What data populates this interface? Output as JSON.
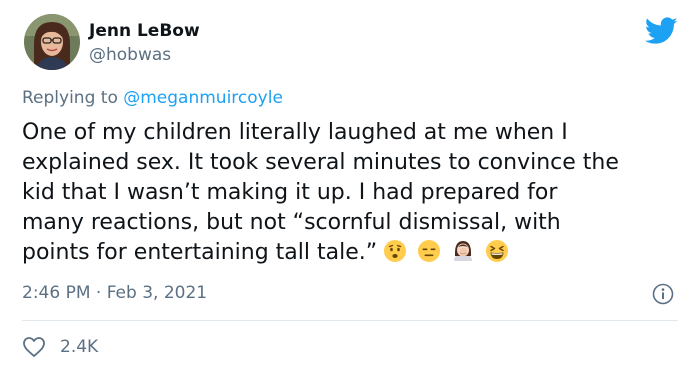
{
  "tweet": {
    "author": {
      "display_name": "Jenn LeBow",
      "handle": "@hobwas"
    },
    "reply_to": {
      "prefix": "Replying to",
      "mention": "@meganmuircoyle"
    },
    "text_lines": [
      "One of my children literally laughed at me when I",
      "explained sex. It took several minutes to convince the",
      "kid that I wasn’t making it up. I had prepared for",
      "many reactions, but not “scornful dismissal, with",
      "points for entertaining tall tale.”"
    ],
    "emoji_icons": [
      "worried-face-icon",
      "expressionless-face-icon",
      "woman-facepalming-icon",
      "grinning-squinting-face-icon"
    ],
    "timestamp": "2:46 PM · Feb 3, 2021",
    "like_count": "2.4K"
  },
  "colors": {
    "twitter_blue": "#1da1f2",
    "secondary_text": "#5b7083",
    "primary_text": "#0f1419",
    "divider": "#e1e8ed"
  },
  "icons": {
    "brand": "twitter-bird-icon",
    "info": "info-icon",
    "like": "heart-outline-icon"
  }
}
